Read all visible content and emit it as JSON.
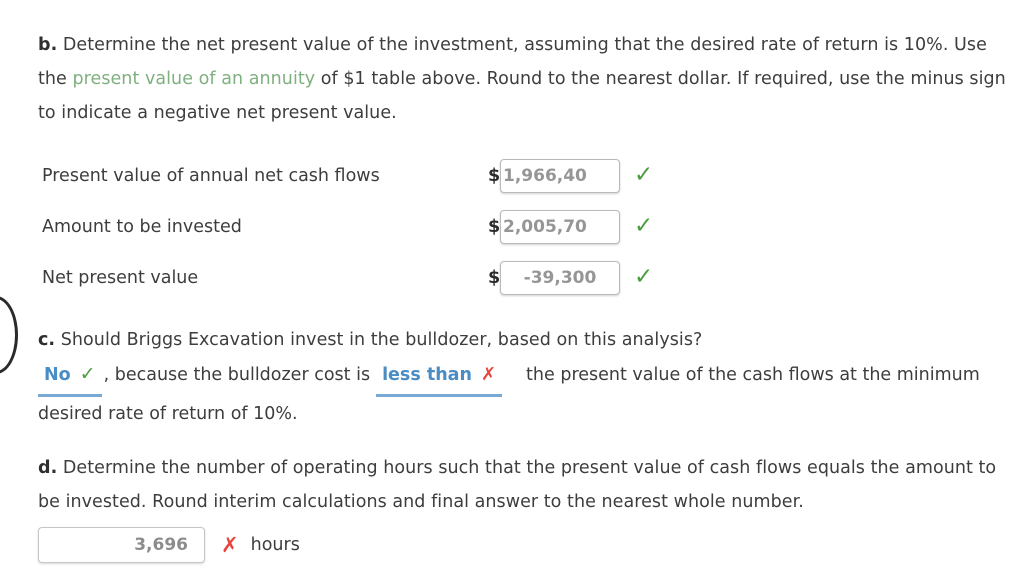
{
  "colors": {
    "text": "#3d3d3d",
    "green_link": "#7fb07f",
    "check_green": "#4a9d3f",
    "cross_red": "#e8453c",
    "dropdown_blue": "#4a8cc4",
    "dropdown_underline": "#7aa8d4",
    "input_value_gray": "#969696"
  },
  "part_b": {
    "marker": "b.",
    "text_before_link": "Determine the net present value of the investment, assuming that the desired rate of return is 10%. Use the ",
    "link_text": "present value of an annuity",
    "text_after_link": " of $1 table above. Round to the nearest dollar. If required, use the minus sign to indicate a negative net present value.",
    "rows": [
      {
        "label": "Present value of annual net cash flows",
        "currency_symbol": "$",
        "value": "1,966,40",
        "align": "align-left",
        "status_icon": "check-icon",
        "status_glyph": "✓",
        "status": "correct"
      },
      {
        "label": "Amount to be invested",
        "currency_symbol": "$",
        "value": "2,005,70",
        "align": "align-left",
        "status_icon": "check-icon",
        "status_glyph": "✓",
        "status": "correct"
      },
      {
        "label": "Net present value",
        "currency_symbol": "$",
        "value": "-39,300",
        "align": "align-center",
        "status_icon": "check-icon",
        "status_glyph": "✓",
        "status": "correct"
      }
    ]
  },
  "part_c": {
    "marker": "c.",
    "question": "Should Briggs Excavation invest in the bulldozer, based on this analysis?",
    "dropdown_1": {
      "value": "No",
      "status_icon": "check-icon",
      "status_glyph": "✓",
      "status": "correct"
    },
    "mid_text": ", because the bulldozer cost is",
    "dropdown_2": {
      "value": "less than",
      "status_icon": "cross-icon",
      "status_glyph": "✗",
      "status": "incorrect"
    },
    "tail_text": "the present value of the cash flows at the minimum desired rate of return of 10%."
  },
  "part_d": {
    "marker": "d.",
    "text": "Determine the number of operating hours such that the present value of cash flows equals the amount to be invested. Round interim calculations and final answer to the nearest whole number.",
    "answer": {
      "value": "3,696",
      "status_icon": "cross-icon",
      "status_glyph": "✗",
      "status": "incorrect",
      "unit": "hours"
    }
  }
}
